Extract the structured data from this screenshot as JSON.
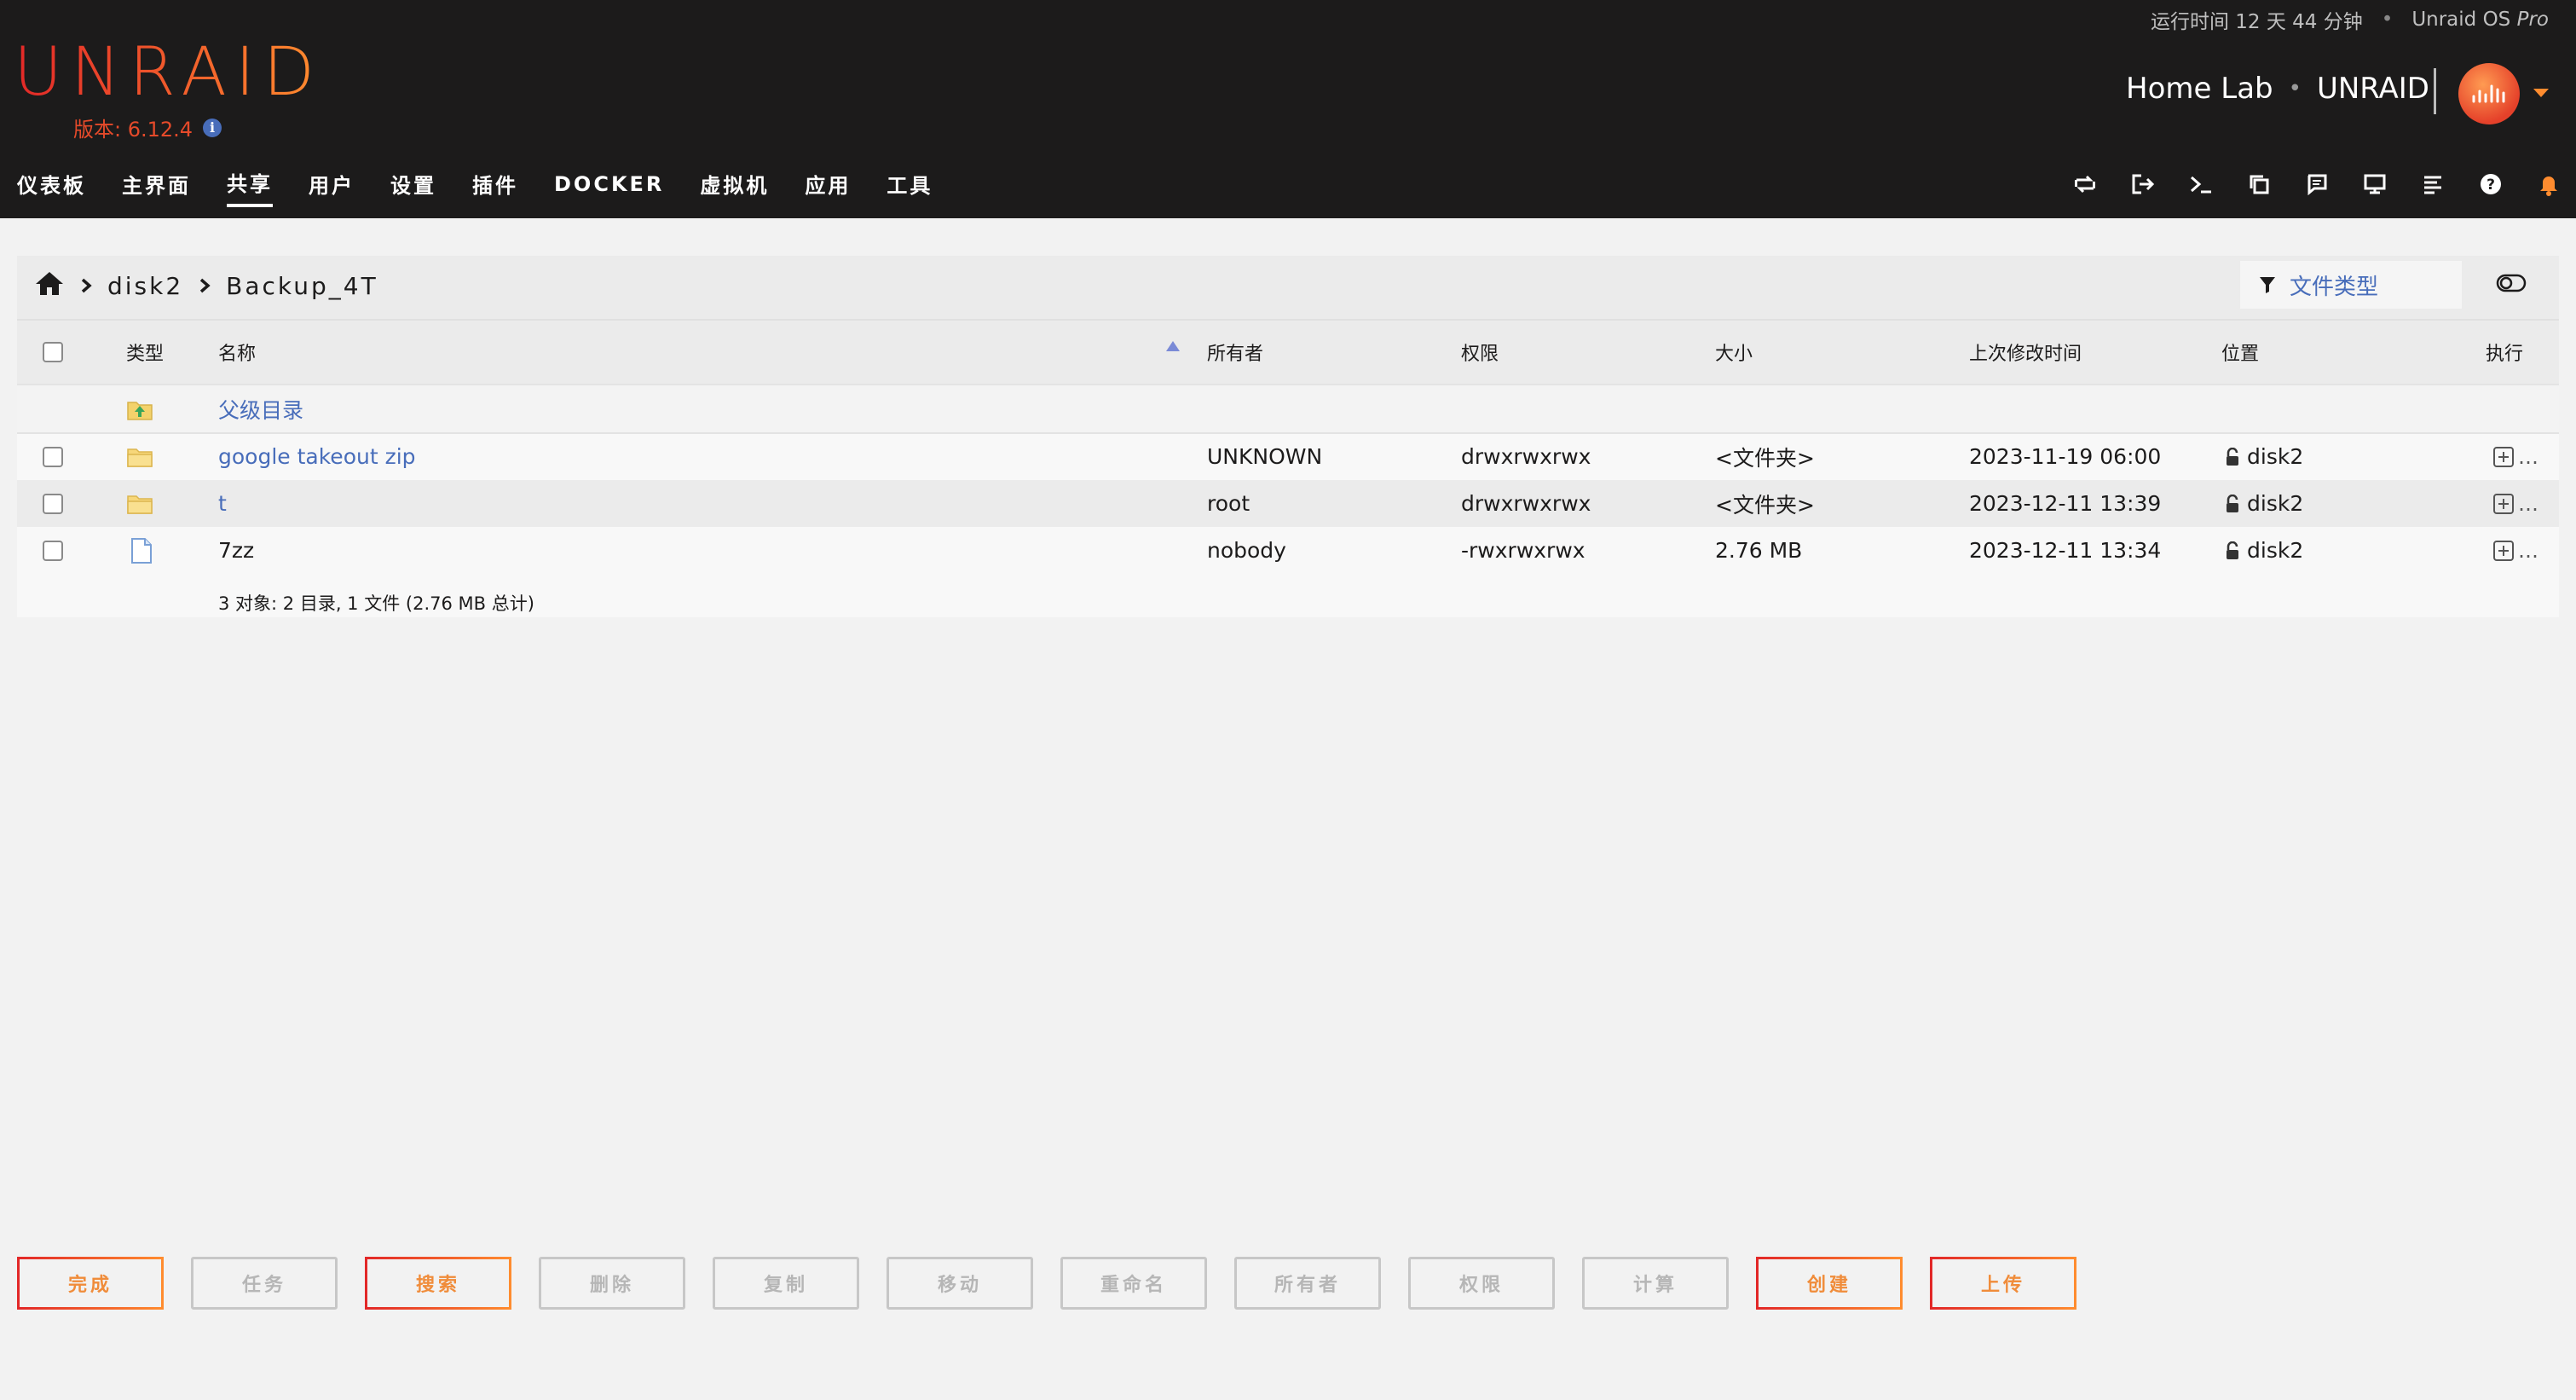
{
  "header": {
    "uptime": "运行时间 12 天 44 分钟",
    "os_name": "Unraid OS ",
    "os_edition": "Pro",
    "logo": "UNRAID",
    "version": "版本: 6.12.4",
    "server_name": "Home Lab",
    "server_type": "UNRAID"
  },
  "nav": {
    "items": [
      "仪表板",
      "主界面",
      "共享",
      "用户",
      "设置",
      "插件",
      "DOCKER",
      "虚拟机",
      "应用",
      "工具"
    ],
    "active": "共享",
    "icons": [
      "sync-icon",
      "logout-icon",
      "terminal-icon",
      "copy-icon",
      "feedback-icon",
      "monitor-icon",
      "log-icon",
      "help-icon",
      "bell-icon"
    ]
  },
  "breadcrumb": {
    "items": [
      "disk2",
      "Backup_4T"
    ],
    "filter_label": "文件类型"
  },
  "table": {
    "headers": {
      "type": "类型",
      "name": "名称",
      "owner": "所有者",
      "perms": "权限",
      "size": "大小",
      "modified": "上次修改时间",
      "location": "位置",
      "action": "执行"
    },
    "parent_label": "父级目录",
    "rows": [
      {
        "name": "google takeout zip",
        "owner": "UNKNOWN",
        "perms": "drwxrwxrwx",
        "size": "<文件夹>",
        "modified": "2023-11-19 06:00",
        "location": "disk2",
        "kind": "folder"
      },
      {
        "name": "t",
        "owner": "root",
        "perms": "drwxrwxrwx",
        "size": "<文件夹>",
        "modified": "2023-12-11 13:39",
        "location": "disk2",
        "kind": "folder"
      },
      {
        "name": "7zz",
        "owner": "nobody",
        "perms": "-rwxrwxrwx",
        "size": "2.76 MB",
        "modified": "2023-12-11 13:34",
        "location": "disk2",
        "kind": "file"
      }
    ],
    "summary": "3 对象: 2 目录, 1 文件 (2.76 MB 总计)"
  },
  "buttons": [
    {
      "label": "完成",
      "enabled": true
    },
    {
      "label": "任务",
      "enabled": false
    },
    {
      "label": "搜索",
      "enabled": true
    },
    {
      "label": "删除",
      "enabled": false
    },
    {
      "label": "复制",
      "enabled": false
    },
    {
      "label": "移动",
      "enabled": false
    },
    {
      "label": "重命名",
      "enabled": false
    },
    {
      "label": "所有者",
      "enabled": false
    },
    {
      "label": "权限",
      "enabled": false
    },
    {
      "label": "计算",
      "enabled": false
    },
    {
      "label": "创建",
      "enabled": true
    },
    {
      "label": "上传",
      "enabled": true
    }
  ],
  "colors": {
    "accent_start": "#e22828",
    "accent_end": "#ff8c2f",
    "link": "#486dba",
    "header_bg": "#1c1b1b"
  }
}
